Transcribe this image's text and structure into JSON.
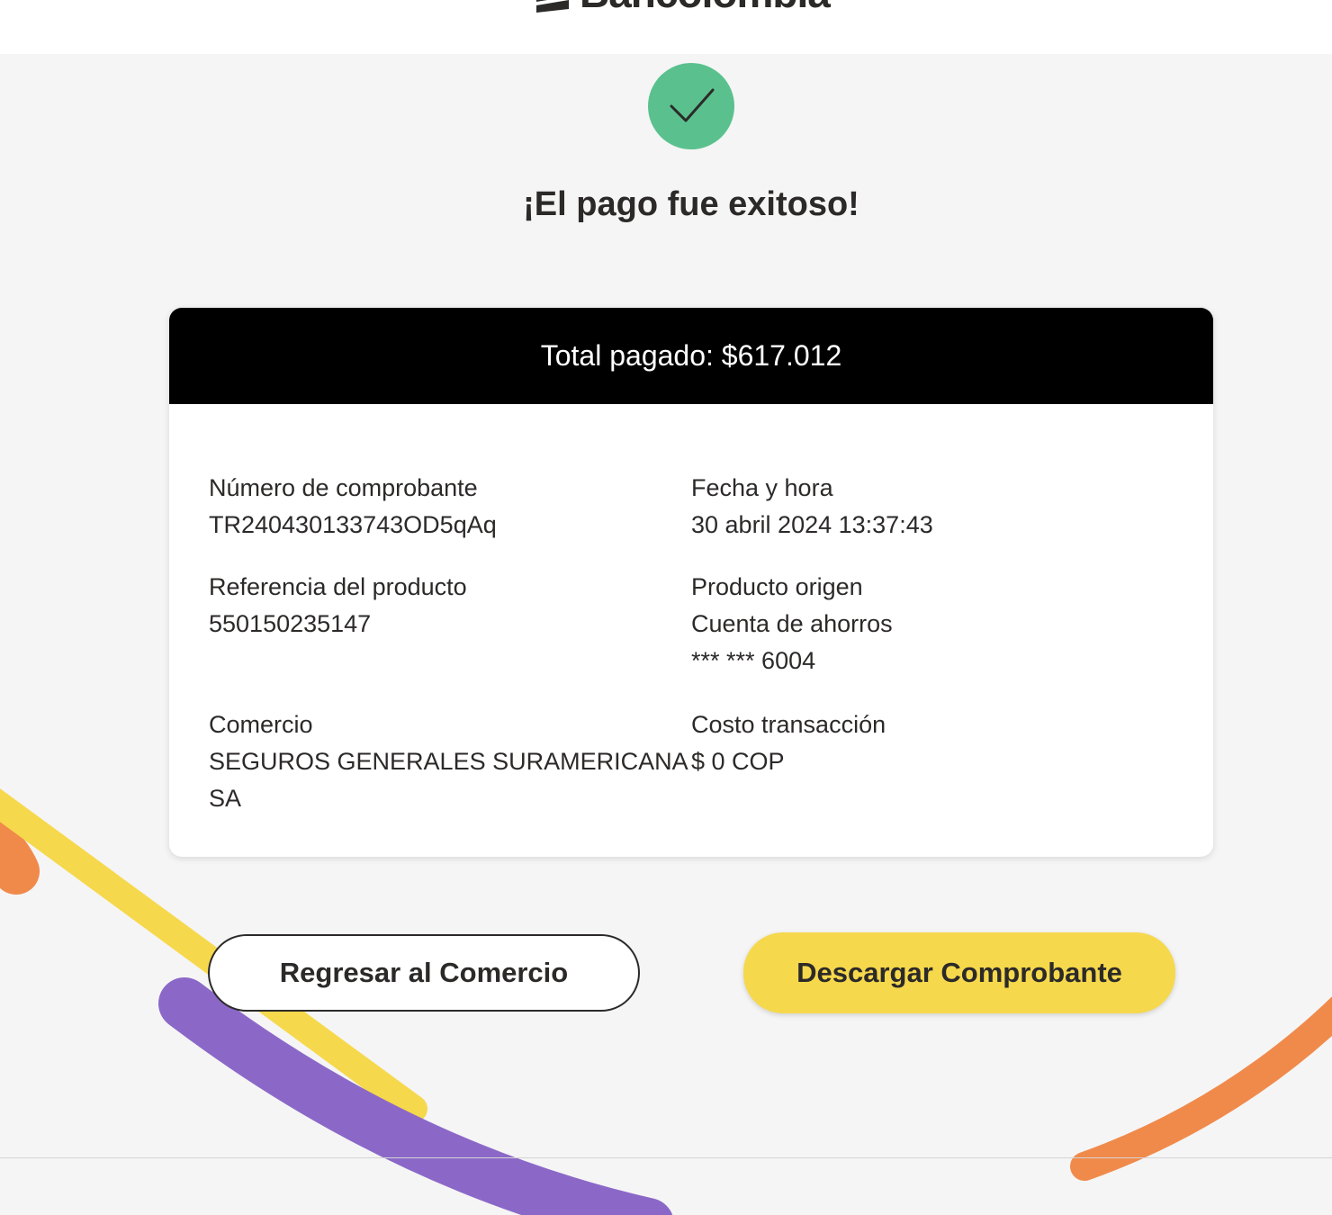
{
  "brand": {
    "name": "Bancolombia",
    "logo_icon": "bancolombia-logo-icon"
  },
  "status": {
    "icon": "check-icon",
    "color": "#5ac18e",
    "title": "¡El pago fue exitoso!"
  },
  "receipt": {
    "total": "Total pagado: $617.012",
    "fields": {
      "voucher_label": "Número de comprobante",
      "voucher_value": "TR240430133743OD5qAq",
      "datetime_label": "Fecha y hora",
      "datetime_value": "30 abril 2024 13:37:43",
      "reference_label": "Referencia del producto",
      "reference_value": "550150235147",
      "origin_label": "Producto origen",
      "origin_value": "Cuenta de ahorros",
      "origin_account": "*** *** 6004",
      "merchant_label": "Comercio",
      "merchant_value": "SEGUROS GENERALES SURAMERICANA",
      "merchant_value_line2": "SA",
      "cost_label": "Costo transacción",
      "cost_value": "$ 0 COP"
    }
  },
  "actions": {
    "return_label": "Regresar al Comercio",
    "download_label": "Descargar Comprobante"
  },
  "colors": {
    "accent_yellow": "#f6d84c",
    "decor_orange": "#f08a4b",
    "decor_purple": "#8b68c8",
    "success_green": "#5ac18e"
  }
}
